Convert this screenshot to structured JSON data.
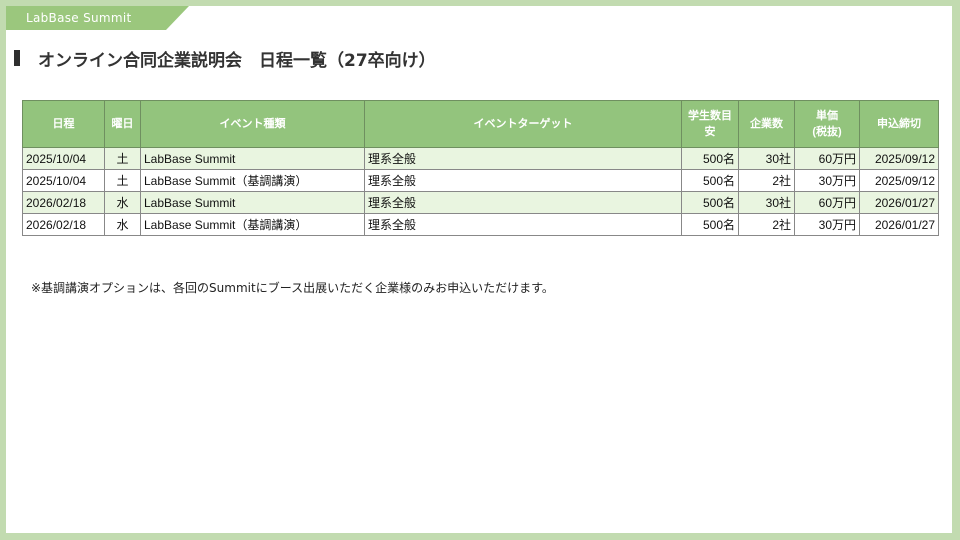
{
  "tag": "LabBase Summit",
  "title": "オンライン合同企業説明会　日程一覧（27卒向け）",
  "table": {
    "headers": [
      "日程",
      "曜日",
      "イベント種類",
      "イベントターゲット",
      "学生数目安",
      "企業数",
      "単価\n(税抜)",
      "申込締切"
    ],
    "rows": [
      [
        "2025/10/04",
        "土",
        "LabBase Summit",
        "理系全般",
        "500名",
        "30社",
        "60万円",
        "2025/09/12"
      ],
      [
        "2025/10/04",
        "土",
        "LabBase Summit（基調講演）",
        "理系全般",
        "500名",
        "2社",
        "30万円",
        "2025/09/12"
      ],
      [
        "2026/02/18",
        "水",
        "LabBase Summit",
        "理系全般",
        "500名",
        "30社",
        "60万円",
        "2026/01/27"
      ],
      [
        "2026/02/18",
        "水",
        "LabBase Summit（基調講演）",
        "理系全般",
        "500名",
        "2社",
        "30万円",
        "2026/01/27"
      ]
    ]
  },
  "note": "※基調講演オプションは、各回のSummitにブース出展いただく企業様のみお申込いただけます。",
  "colors": {
    "header_bg": "#93c47d",
    "alt_row_bg": "#e9f5e0",
    "frame": "#c2dbb0",
    "tag_bg": "#9bc77d"
  }
}
